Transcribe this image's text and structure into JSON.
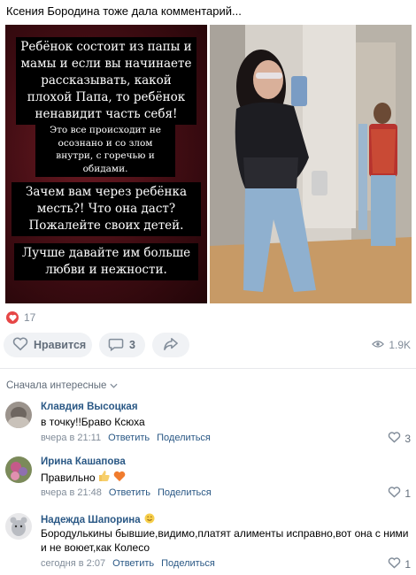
{
  "post": {
    "text": "Ксения Бородина тоже дала комментарий...",
    "story_blocks": [
      "Ребёнок состоит из папы и мамы и если вы начинаете рассказывать, какой плохой Папа, то ребёнок ненавидит часть себя!",
      "Это все происходит не осознано и со злом внутри, с горечью и обидами.",
      "Зачем вам через ребёнка месть?! Что она даст? Пожалейте своих детей.",
      "Лучше давайте им больше любви и нежности."
    ],
    "likes_count": "17",
    "like_label": "Нравится",
    "comments_count": "3",
    "views": "1.9K"
  },
  "sort_label": "Сначала интересные",
  "comments": [
    {
      "author": "Клавдия Высоцкая",
      "text": "в точку!!Браво Ксюха",
      "time": "вчера в 21:11",
      "reply": "Ответить",
      "share": "Поделиться",
      "likes": "3"
    },
    {
      "author": "Ирина Кашапова",
      "text": "Правильно",
      "time": "вчера в 21:48",
      "reply": "Ответить",
      "share": "Поделиться",
      "likes": "1"
    },
    {
      "author": "Надежда Шапорина",
      "text": "Бородулькины бывшие,видимо,платят алименты исправно,вот она с ними и не воюет,как Колесо",
      "time": "сегодня в 2:07",
      "reply": "Ответить",
      "share": "Поделиться",
      "likes": "1"
    }
  ],
  "colors": {
    "link": "#2a5885",
    "muted": "#818c99",
    "heart": "#e64646",
    "pill_bg": "#f0f2f5"
  }
}
